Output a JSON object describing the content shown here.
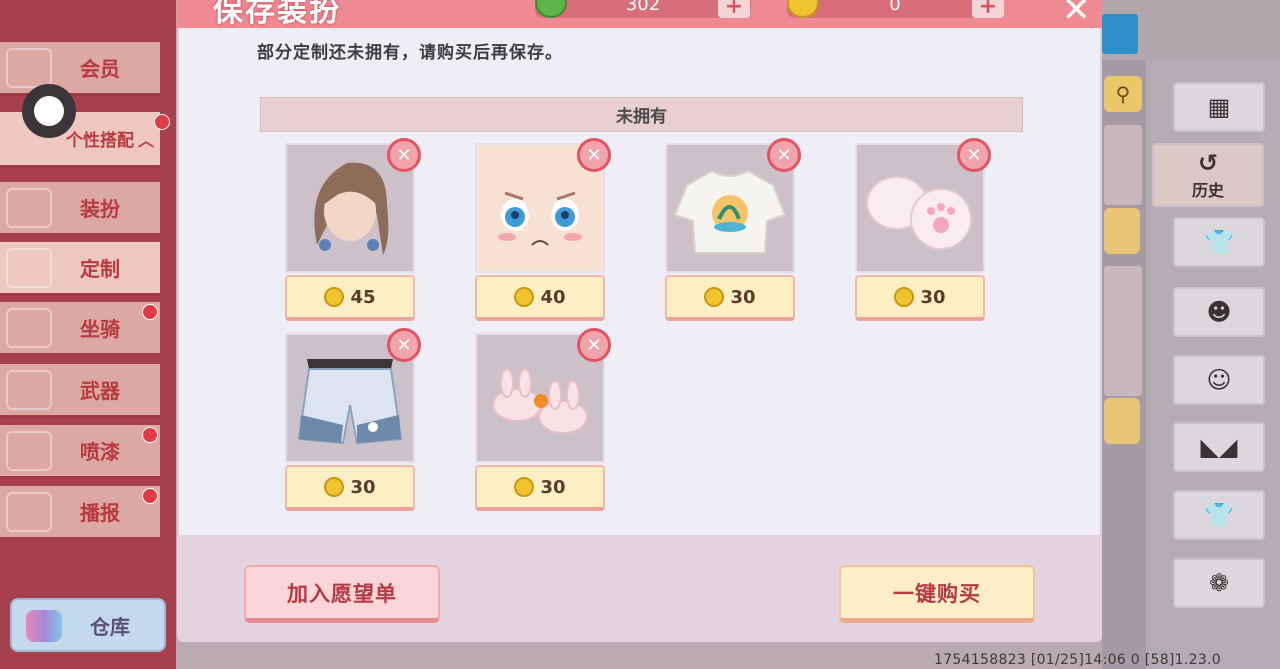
{
  "sidebar": {
    "items": [
      {
        "label": "会员",
        "badge": false
      },
      {
        "label": "个性搭配",
        "badge": true
      },
      {
        "label": "装扮",
        "badge": false
      },
      {
        "label": "定制",
        "badge": false
      },
      {
        "label": "坐骑",
        "badge": true
      },
      {
        "label": "武器",
        "badge": false
      },
      {
        "label": "喷漆",
        "badge": true
      },
      {
        "label": "播报",
        "badge": true
      }
    ],
    "expand_arrow": "︿",
    "warehouse_label": "仓库"
  },
  "right_panel": {
    "history_label": "历史"
  },
  "dialog": {
    "title": "保存装扮",
    "currency1_value": "302",
    "currency2_value": "0",
    "close_icon": "✕",
    "notice": "部分定制还未拥有，请购买后再保存。",
    "section_header": "未拥有",
    "items": [
      {
        "name": "hair",
        "price": "45"
      },
      {
        "name": "face",
        "price": "40"
      },
      {
        "name": "shirt",
        "price": "30"
      },
      {
        "name": "paws",
        "price": "30"
      },
      {
        "name": "shorts",
        "price": "30"
      },
      {
        "name": "slippers",
        "price": "30"
      }
    ],
    "wishlist_button": "加入愿望单",
    "buy_all_button": "一键购买"
  },
  "status_bar": {
    "text": "1754158823   [01/25]14:06 0   [58]1.23.0"
  },
  "colors": {
    "header": "#ef8a93",
    "content_bg": "#efeef6",
    "accent_red": "#e35362",
    "coin_gold": "#f0c42e"
  }
}
